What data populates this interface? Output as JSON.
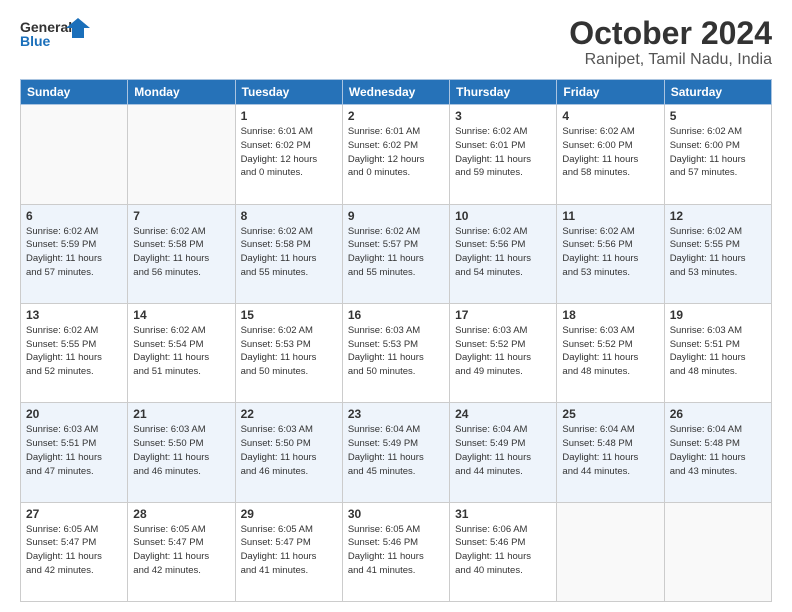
{
  "logo": {
    "line1": "General",
    "line2": "Blue"
  },
  "title": "October 2024",
  "subtitle": "Ranipet, Tamil Nadu, India",
  "days_header": [
    "Sunday",
    "Monday",
    "Tuesday",
    "Wednesday",
    "Thursday",
    "Friday",
    "Saturday"
  ],
  "weeks": [
    [
      {
        "day": "",
        "info": ""
      },
      {
        "day": "",
        "info": ""
      },
      {
        "day": "1",
        "info": "Sunrise: 6:01 AM\nSunset: 6:02 PM\nDaylight: 12 hours\nand 0 minutes."
      },
      {
        "day": "2",
        "info": "Sunrise: 6:01 AM\nSunset: 6:02 PM\nDaylight: 12 hours\nand 0 minutes."
      },
      {
        "day": "3",
        "info": "Sunrise: 6:02 AM\nSunset: 6:01 PM\nDaylight: 11 hours\nand 59 minutes."
      },
      {
        "day": "4",
        "info": "Sunrise: 6:02 AM\nSunset: 6:00 PM\nDaylight: 11 hours\nand 58 minutes."
      },
      {
        "day": "5",
        "info": "Sunrise: 6:02 AM\nSunset: 6:00 PM\nDaylight: 11 hours\nand 57 minutes."
      }
    ],
    [
      {
        "day": "6",
        "info": "Sunrise: 6:02 AM\nSunset: 5:59 PM\nDaylight: 11 hours\nand 57 minutes."
      },
      {
        "day": "7",
        "info": "Sunrise: 6:02 AM\nSunset: 5:58 PM\nDaylight: 11 hours\nand 56 minutes."
      },
      {
        "day": "8",
        "info": "Sunrise: 6:02 AM\nSunset: 5:58 PM\nDaylight: 11 hours\nand 55 minutes."
      },
      {
        "day": "9",
        "info": "Sunrise: 6:02 AM\nSunset: 5:57 PM\nDaylight: 11 hours\nand 55 minutes."
      },
      {
        "day": "10",
        "info": "Sunrise: 6:02 AM\nSunset: 5:56 PM\nDaylight: 11 hours\nand 54 minutes."
      },
      {
        "day": "11",
        "info": "Sunrise: 6:02 AM\nSunset: 5:56 PM\nDaylight: 11 hours\nand 53 minutes."
      },
      {
        "day": "12",
        "info": "Sunrise: 6:02 AM\nSunset: 5:55 PM\nDaylight: 11 hours\nand 53 minutes."
      }
    ],
    [
      {
        "day": "13",
        "info": "Sunrise: 6:02 AM\nSunset: 5:55 PM\nDaylight: 11 hours\nand 52 minutes."
      },
      {
        "day": "14",
        "info": "Sunrise: 6:02 AM\nSunset: 5:54 PM\nDaylight: 11 hours\nand 51 minutes."
      },
      {
        "day": "15",
        "info": "Sunrise: 6:02 AM\nSunset: 5:53 PM\nDaylight: 11 hours\nand 50 minutes."
      },
      {
        "day": "16",
        "info": "Sunrise: 6:03 AM\nSunset: 5:53 PM\nDaylight: 11 hours\nand 50 minutes."
      },
      {
        "day": "17",
        "info": "Sunrise: 6:03 AM\nSunset: 5:52 PM\nDaylight: 11 hours\nand 49 minutes."
      },
      {
        "day": "18",
        "info": "Sunrise: 6:03 AM\nSunset: 5:52 PM\nDaylight: 11 hours\nand 48 minutes."
      },
      {
        "day": "19",
        "info": "Sunrise: 6:03 AM\nSunset: 5:51 PM\nDaylight: 11 hours\nand 48 minutes."
      }
    ],
    [
      {
        "day": "20",
        "info": "Sunrise: 6:03 AM\nSunset: 5:51 PM\nDaylight: 11 hours\nand 47 minutes."
      },
      {
        "day": "21",
        "info": "Sunrise: 6:03 AM\nSunset: 5:50 PM\nDaylight: 11 hours\nand 46 minutes."
      },
      {
        "day": "22",
        "info": "Sunrise: 6:03 AM\nSunset: 5:50 PM\nDaylight: 11 hours\nand 46 minutes."
      },
      {
        "day": "23",
        "info": "Sunrise: 6:04 AM\nSunset: 5:49 PM\nDaylight: 11 hours\nand 45 minutes."
      },
      {
        "day": "24",
        "info": "Sunrise: 6:04 AM\nSunset: 5:49 PM\nDaylight: 11 hours\nand 44 minutes."
      },
      {
        "day": "25",
        "info": "Sunrise: 6:04 AM\nSunset: 5:48 PM\nDaylight: 11 hours\nand 44 minutes."
      },
      {
        "day": "26",
        "info": "Sunrise: 6:04 AM\nSunset: 5:48 PM\nDaylight: 11 hours\nand 43 minutes."
      }
    ],
    [
      {
        "day": "27",
        "info": "Sunrise: 6:05 AM\nSunset: 5:47 PM\nDaylight: 11 hours\nand 42 minutes."
      },
      {
        "day": "28",
        "info": "Sunrise: 6:05 AM\nSunset: 5:47 PM\nDaylight: 11 hours\nand 42 minutes."
      },
      {
        "day": "29",
        "info": "Sunrise: 6:05 AM\nSunset: 5:47 PM\nDaylight: 11 hours\nand 41 minutes."
      },
      {
        "day": "30",
        "info": "Sunrise: 6:05 AM\nSunset: 5:46 PM\nDaylight: 11 hours\nand 41 minutes."
      },
      {
        "day": "31",
        "info": "Sunrise: 6:06 AM\nSunset: 5:46 PM\nDaylight: 11 hours\nand 40 minutes."
      },
      {
        "day": "",
        "info": ""
      },
      {
        "day": "",
        "info": ""
      }
    ]
  ]
}
